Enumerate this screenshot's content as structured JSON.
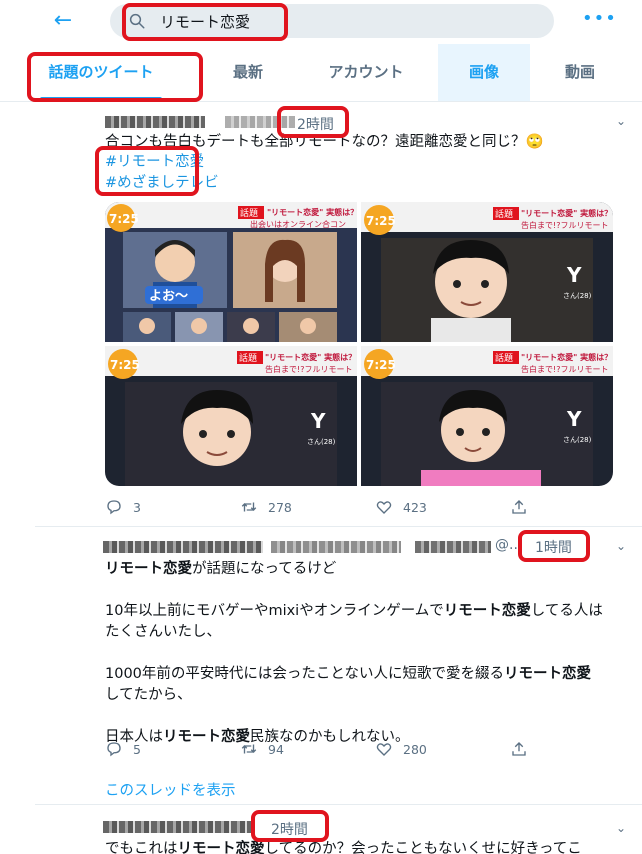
{
  "search": {
    "query": "リモート恋愛"
  },
  "tabs": [
    {
      "label": "話題のツイート"
    },
    {
      "label": "最新"
    },
    {
      "label": "アカウント"
    },
    {
      "label": "画像"
    },
    {
      "label": "動画"
    }
  ],
  "tweets": [
    {
      "time": "2時間",
      "text": "合コンも告白もデートも全部リモートなの？遠距離恋愛と同じ？🙄",
      "hashtags": [
        "#リモート恋愛",
        "#めざましテレビ"
      ],
      "reply_count": "3",
      "retweet_count": "278",
      "like_count": "423"
    },
    {
      "handle_suffix": "@...",
      "time": "1時間",
      "p1_bold": "リモート恋愛",
      "p1_rest": "が話題になってるけど",
      "p2_a": "10年以上前にモバゲーやmixiやオンラインゲームで",
      "p2_bold": "リモート恋愛",
      "p2_b": "してる人は",
      "p2_c": "たくさんいたし、",
      "p3_a": "1000年前の平安時代には会ったことない人に短歌で愛を綴る",
      "p3_bold": "リモート恋愛",
      "p3_b": "してたから、",
      "p4_a": "日本人は",
      "p4_bold": "リモート恋愛",
      "p4_b": "民族なのかもしれない。",
      "reply_count": "5",
      "retweet_count": "94",
      "like_count": "280",
      "thread_link": "このスレッドを表示"
    },
    {
      "time": "2時間",
      "text_a": "でもこれは",
      "text_bold": "リモート恋愛",
      "text_b": "してるのか？会ったこともないくせに好きってこ"
    }
  ],
  "tv_overlay": {
    "clock": "7:25",
    "topic_badge": "話題",
    "headline": "\"リモート恋愛\" 実態は？",
    "sub_a": "出会いはオンライン合コン",
    "sub_b": "告白まで!?フルリモート",
    "caption_yo": "よお～",
    "person_letter": "Y",
    "person_note": "さん(28)"
  },
  "colors": {
    "accent": "#1da1f2",
    "highlight": "#e0141e",
    "muted": "#5b7083"
  }
}
